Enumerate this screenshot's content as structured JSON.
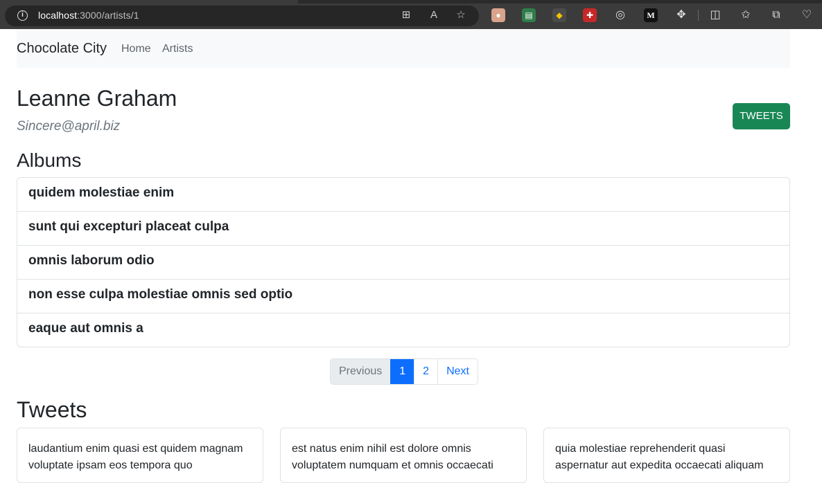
{
  "browser": {
    "url_host": "localhost",
    "url_rest": ":3000/artists/1",
    "address_icons": [
      "app-available-icon",
      "read-aloud-icon",
      "favorite-star-icon"
    ],
    "extensions": [
      "ext-owl-icon",
      "ext-sheet-icon",
      "ext-colors-icon",
      "ext-puzzle-red-icon",
      "ext-target-icon",
      "ext-medium-icon"
    ],
    "ext_medium_label": "M",
    "toolbar_icons": [
      "extensions-icon",
      "split-screen-icon",
      "favorites-icon",
      "collections-icon",
      "browser-essentials-icon"
    ]
  },
  "navbar": {
    "brand": "Chocolate City",
    "links": [
      "Home",
      "Artists"
    ]
  },
  "artist": {
    "name": "Leanne Graham",
    "email": "Sincere@april.biz",
    "tweets_button": "TWEETS"
  },
  "albums": {
    "heading": "Albums",
    "items": [
      "quidem molestiae enim",
      "sunt qui excepturi placeat culpa",
      "omnis laborum odio",
      "non esse culpa molestiae omnis sed optio",
      "eaque aut omnis a"
    ]
  },
  "pagination": {
    "previous": "Previous",
    "pages": [
      "1",
      "2"
    ],
    "active_page": "1",
    "next": "Next"
  },
  "tweets": {
    "heading": "Tweets",
    "cards": [
      "laudantium enim quasi est quidem magnam voluptate ipsam eos tempora quo",
      "est natus enim nihil est dolore omnis voluptatem numquam et omnis occaecati",
      "quia molestiae reprehenderit quasi aspernatur aut expedita occaecati aliquam"
    ]
  },
  "colors": {
    "success": "#198754",
    "primary": "#0d6efd",
    "navbar_bg": "#f8f9fa"
  }
}
